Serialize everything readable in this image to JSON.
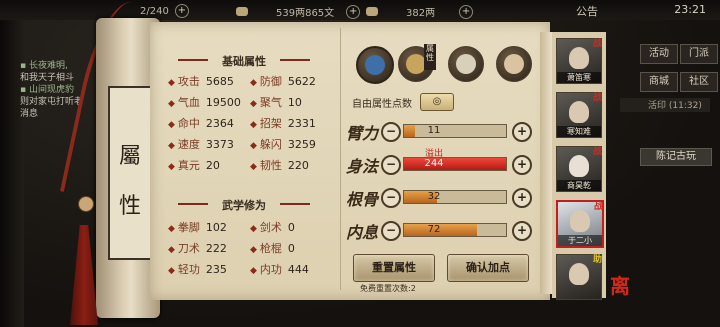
{
  "topbar": {
    "res1_value": "2/240",
    "res2_value": "539两865文",
    "res3_value": "382两",
    "announcement": "公告",
    "clock": "23:21"
  },
  "chat": [
    "长夜难明,",
    "和我天子相斗",
    "山间现虎豹",
    "则对家屯打听老",
    "消息"
  ],
  "roll": {
    "tab_char1": "屬",
    "tab_char2": "性"
  },
  "basic": {
    "title": "基础属性",
    "stats": [
      {
        "label": "攻击",
        "value": "5685"
      },
      {
        "label": "防御",
        "value": "5622"
      },
      {
        "label": "气血",
        "value": "19500"
      },
      {
        "label": "聚气",
        "value": "10"
      },
      {
        "label": "命中",
        "value": "2364"
      },
      {
        "label": "招架",
        "value": "2331"
      },
      {
        "label": "速度",
        "value": "3373"
      },
      {
        "label": "躲闪",
        "value": "3259"
      },
      {
        "label": "真元",
        "value": "20"
      },
      {
        "label": "韧性",
        "value": "220"
      }
    ]
  },
  "martial": {
    "title": "武学修为",
    "stats": [
      {
        "label": "拳脚",
        "value": "102"
      },
      {
        "label": "剑术",
        "value": "0"
      },
      {
        "label": "刀术",
        "value": "222"
      },
      {
        "label": "枪棍",
        "value": "0"
      },
      {
        "label": "轻功",
        "value": "235"
      },
      {
        "label": "内功",
        "value": "444"
      }
    ]
  },
  "points": {
    "stamp": "属性",
    "free_label": "自由属性点数",
    "coin_icon": "◎",
    "overflow_label": "溢出",
    "rows": [
      {
        "label": "臂力",
        "value": "11",
        "fill": 0.11
      },
      {
        "label": "身法",
        "value": "244",
        "fill": 1.0
      },
      {
        "label": "根骨",
        "value": "32",
        "fill": 0.32
      },
      {
        "label": "内息",
        "value": "72",
        "fill": 0.72
      }
    ],
    "reset_button": "重置属性",
    "confirm_button": "确认加点",
    "reset_count": "免费重置次数:2"
  },
  "portraits": [
    {
      "name": "萧笛寒",
      "badge": "战"
    },
    {
      "name": "寒知难",
      "badge": "战"
    },
    {
      "name": "商昊乾",
      "badge": "战"
    },
    {
      "name": "于二小",
      "badge": "战"
    },
    {
      "name": "",
      "badge": "助"
    }
  ],
  "corner_char": "离",
  "nav": {
    "n1": "活动",
    "n2": "门派",
    "n3": "商城",
    "n4": "社区",
    "n5": "活印",
    "n5_sub": "(11:32)",
    "note": "陈记古玩"
  }
}
